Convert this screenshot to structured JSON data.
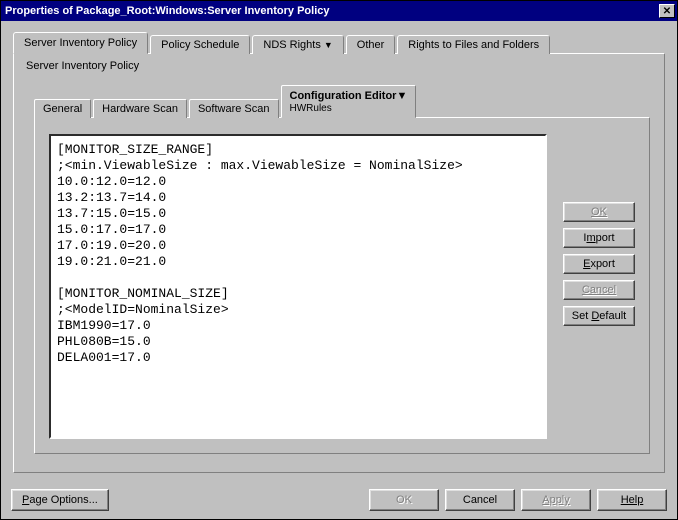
{
  "window": {
    "title": "Properties of Package_Root:Windows:Server Inventory Policy"
  },
  "topTabs": {
    "items": [
      {
        "label": "Server Inventory Policy",
        "active": true
      },
      {
        "label": "Policy Schedule"
      },
      {
        "label": "NDS Rights",
        "dropdown": true
      },
      {
        "label": "Other"
      },
      {
        "label": "Rights to Files and Folders"
      }
    ],
    "subtitle": "Server Inventory Policy"
  },
  "innerTabs": {
    "items": [
      {
        "label": "General"
      },
      {
        "label": "Hardware Scan"
      },
      {
        "label": "Software Scan"
      },
      {
        "label": "Configuration Editor",
        "sub": "HWRules",
        "dropdown": true,
        "active": true
      }
    ]
  },
  "editor": {
    "text": "[MONITOR_SIZE_RANGE]\n;<min.ViewableSize : max.ViewableSize = NominalSize>\n10.0:12.0=12.0\n13.2:13.7=14.0\n13.7:15.0=15.0\n15.0:17.0=17.0\n17.0:19.0=20.0\n19.0:21.0=21.0\n\n[MONITOR_NOMINAL_SIZE]\n;<ModelID=NominalSize>\nIBM1990=17.0\nPHL080B=15.0\nDELA001=17.0"
  },
  "sideButtons": {
    "ok": "OK",
    "import": "Import",
    "export": "Export",
    "cancel": "Cancel",
    "setDefault": "Set Default"
  },
  "footer": {
    "pageOptions": "Page Options...",
    "ok": "OK",
    "cancel": "Cancel",
    "apply": "Apply",
    "help": "Help"
  }
}
